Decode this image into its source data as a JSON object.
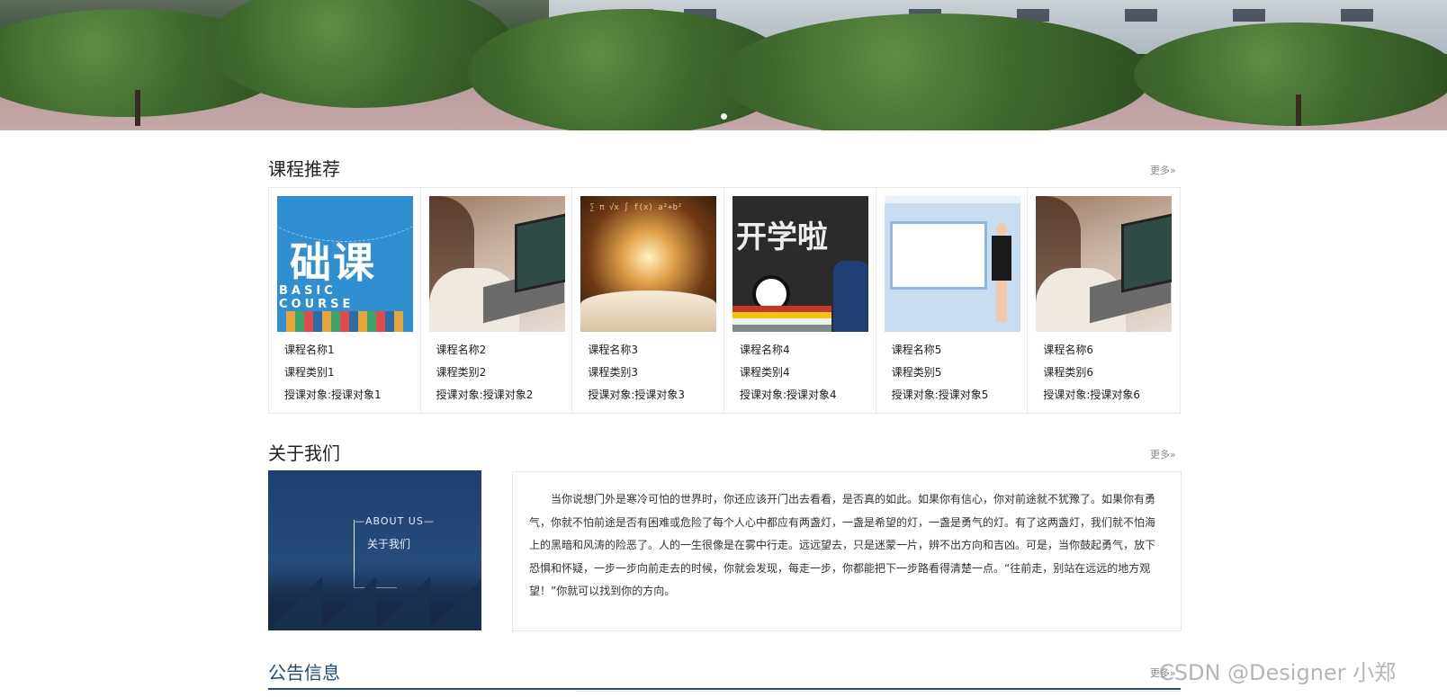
{
  "banner": {
    "slide_indicator": "slide-dot-1"
  },
  "courses_section": {
    "title": "课程推荐",
    "more": "更多»",
    "items": [
      {
        "name": "课程名称1",
        "category": "课程类别1",
        "audience": "授课对象:授课对象1",
        "image": "basic-course-image"
      },
      {
        "name": "课程名称2",
        "category": "课程类别2",
        "audience": "授课对象:授课对象2",
        "image": "laptop-study-image"
      },
      {
        "name": "课程名称3",
        "category": "课程类别3",
        "audience": "授课对象:授课对象3",
        "image": "open-book-image"
      },
      {
        "name": "课程名称4",
        "category": "课程类别4",
        "audience": "授课对象:授课对象4",
        "image": "chalkboard-image"
      },
      {
        "name": "课程名称5",
        "category": "课程类别5",
        "audience": "授课对象:授课对象5",
        "image": "presenter-image"
      },
      {
        "name": "课程名称6",
        "category": "课程类别6",
        "audience": "授课对象:授课对象6",
        "image": "laptop-study-image"
      }
    ],
    "thumb_texts": {
      "basic_big": "础课",
      "basic_sub": "BASIC COURSE",
      "chalk": "开学啦"
    }
  },
  "about_section": {
    "title": "关于我们",
    "more": "更多»",
    "image_en": "—ABOUT US—",
    "image_cn": "关于我们",
    "text": "当你说想门外是寒冷可怕的世界时，你还应该开门出去看看，是否真的如此。如果你有信心，你对前途就不犹豫了。如果你有勇气，你就不怕前途是否有困难或危险了每个人心中都应有两盏灯，一盏是希望的灯，一盏是勇气的灯。有了这两盏灯，我们就不怕海上的黑暗和风涛的险恶了。人的一生很像是在雾中行走。远远望去，只是迷蒙一片，辨不出方向和吉凶。可是，当你鼓起勇气，放下恐惧和怀疑，一步一步向前走去的时候，你就会发现，每走一步，你都能把下一步路看得清楚一点。“往前走，别站在远远的地方观望！”你就可以找到你的方向。"
  },
  "notice_section": {
    "title": "公告信息",
    "more": "更多»"
  },
  "watermark": "CSDN @Designer 小郑",
  "colors": {
    "notice_accent": "#1f4c7a",
    "border": "#e6e6e6",
    "more_text": "#888888"
  }
}
